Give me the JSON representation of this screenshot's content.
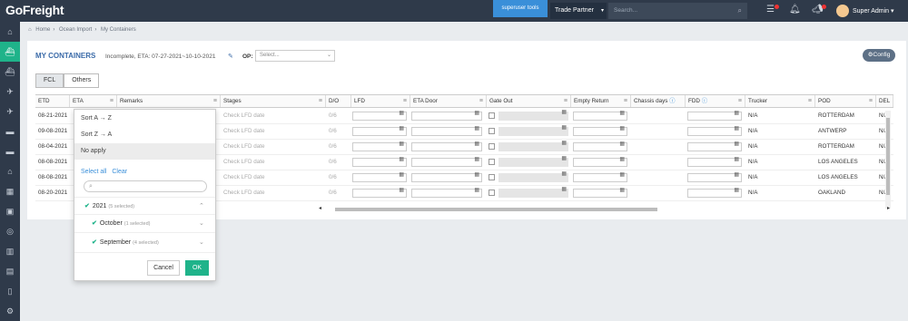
{
  "app": {
    "logo": "GoFreight"
  },
  "topbar": {
    "superuser_tools": "superuser tools",
    "trade_partner": "Trade Partner",
    "search_placeholder": "Search...",
    "user_name": "Super Admin",
    "icons": [
      "list-icon",
      "bell-icon",
      "megaphone-icon"
    ]
  },
  "sidebar": {
    "items": [
      "home-icon",
      "ship-icon",
      "ship-icon",
      "plane-icon",
      "plane-icon",
      "truck-icon",
      "truck-icon",
      "warehouse-icon",
      "calculator-icon",
      "briefcase-icon",
      "coins-icon",
      "chart-icon",
      "document-icon",
      "book-icon",
      "gear-icon"
    ],
    "active_index": 1
  },
  "breadcrumb": [
    "Home",
    "Ocean Import",
    "My Containers"
  ],
  "page": {
    "title": "MY CONTAINERS",
    "subtitle": "Incomplete, ETA: 07-27-2021~10-10-2021",
    "op_label": "OP:",
    "op_placeholder": "Select...",
    "config": "Config"
  },
  "tabs": [
    "FCL",
    "Others"
  ],
  "columns": [
    {
      "label": "ETD",
      "menu": true
    },
    {
      "label": "ETA",
      "menu": true
    },
    {
      "label": "Remarks",
      "menu": true
    },
    {
      "label": "Stages",
      "menu": true
    },
    {
      "label": "D/O",
      "menu": false
    },
    {
      "label": "LFD",
      "menu": true
    },
    {
      "label": "ETA Door",
      "menu": true
    },
    {
      "label": "Gate Out",
      "menu": true
    },
    {
      "label": "Empty Return",
      "menu": true
    },
    {
      "label": "Chassis days",
      "menu": false,
      "info": true
    },
    {
      "label": "FDD",
      "menu": true,
      "info": true
    },
    {
      "label": "Trucker",
      "menu": true
    },
    {
      "label": "POD",
      "menu": true
    },
    {
      "label": "DEL",
      "menu": false
    }
  ],
  "rows": [
    {
      "etd": "08-21-2021",
      "stage": "Check LFD date",
      "do": "0/6",
      "trucker": "N/A",
      "pod": "ROTTERDAM",
      "del": "N/A"
    },
    {
      "etd": "09-08-2021",
      "stage": "Check LFD date",
      "do": "0/6",
      "trucker": "N/A",
      "pod": "ANTWERP",
      "del": "N/A"
    },
    {
      "etd": "08-04-2021",
      "stage": "Check LFD date",
      "do": "0/6",
      "trucker": "N/A",
      "pod": "ROTTERDAM",
      "del": "N/A"
    },
    {
      "etd": "08-08-2021",
      "stage": "Check LFD date",
      "do": "0/6",
      "trucker": "N/A",
      "pod": "LOS ANGELES",
      "del": "N/A"
    },
    {
      "etd": "08-08-2021",
      "stage": "Check LFD date",
      "do": "0/6",
      "trucker": "N/A",
      "pod": "LOS ANGELES",
      "del": "N/A"
    },
    {
      "etd": "08-20-2021",
      "stage": "Check LFD date",
      "do": "0/6",
      "trucker": "N/A",
      "pod": "OAKLAND",
      "del": "N/A"
    }
  ],
  "filter_popup": {
    "sort_asc": "Sort A → Z",
    "sort_desc": "Sort Z → A",
    "no_apply": "No apply",
    "select_all": "Select all",
    "clear": "Clear",
    "tree": [
      {
        "label": "2021",
        "count": "(5 selected)"
      },
      {
        "label": "October",
        "count": "(1 selected)"
      },
      {
        "label": "September",
        "count": "(4 selected)"
      }
    ],
    "cancel": "Cancel",
    "ok": "OK"
  },
  "colors": {
    "accent": "#1fb38a",
    "nav": "#2f3a4a",
    "link": "#3a8fd9",
    "title": "#3a6aa8"
  }
}
